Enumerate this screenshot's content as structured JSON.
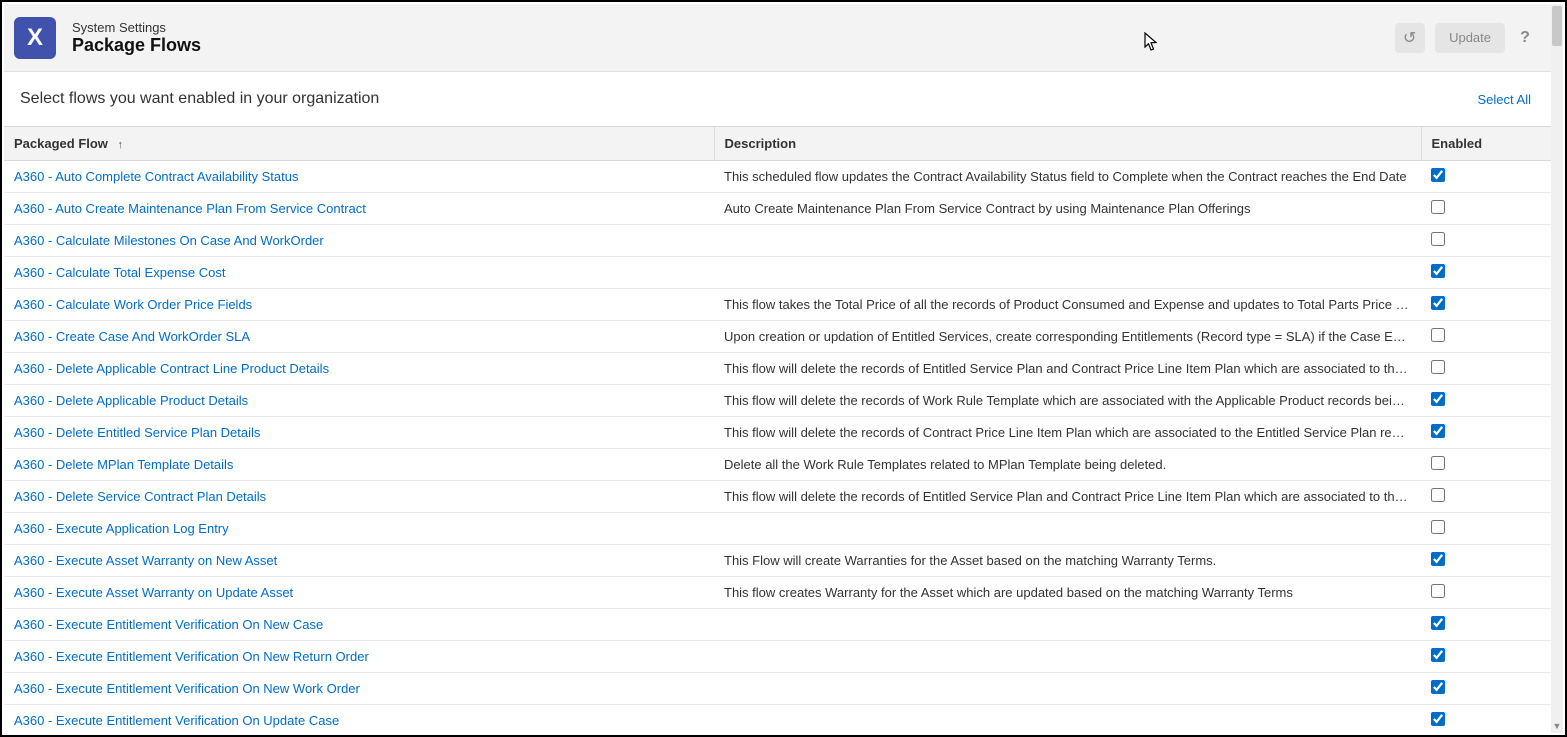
{
  "header": {
    "logo_letter": "X",
    "breadcrumb": "System Settings",
    "title": "Package Flows",
    "undo_label": "Undo",
    "update_label": "Update",
    "help_label": "?"
  },
  "subheader": {
    "text": "Select flows you want enabled in your organization",
    "select_all": "Select All"
  },
  "columns": {
    "flow": "Packaged Flow",
    "sort_indicator": "↑",
    "description": "Description",
    "enabled": "Enabled"
  },
  "rows": [
    {
      "name": "A360 - Auto Complete Contract Availability Status",
      "description": "This scheduled flow updates the Contract Availability Status field to Complete when the Contract reaches the End Date",
      "enabled": true
    },
    {
      "name": "A360 - Auto Create Maintenance Plan From Service Contract",
      "description": "Auto Create Maintenance Plan From Service Contract by using Maintenance Plan Offerings",
      "enabled": false
    },
    {
      "name": "A360 - Calculate Milestones On Case And WorkOrder",
      "description": "",
      "enabled": false
    },
    {
      "name": "A360 - Calculate Total Expense Cost",
      "description": "",
      "enabled": true
    },
    {
      "name": "A360 - Calculate Work Order Price Fields",
      "description": "This flow takes the Total Price of all the records of Product Consumed and Expense and updates to Total Parts Price and …",
      "enabled": true
    },
    {
      "name": "A360 - Create Case And WorkOrder SLA",
      "description": "Upon creation or updation of Entitled Services, create corresponding Entitlements (Record type = SLA) if the Case Entitl…",
      "enabled": false
    },
    {
      "name": "A360 - Delete Applicable Contract Line Product Details",
      "description": "This flow will delete the records of Entitled Service Plan and Contract Price Line Item Plan which are associated to the A…",
      "enabled": false
    },
    {
      "name": "A360 - Delete Applicable Product Details",
      "description": "This flow will delete the records of Work Rule Template which are associated with the Applicable Product records being …",
      "enabled": true
    },
    {
      "name": "A360 - Delete Entitled Service Plan Details",
      "description": "This flow will delete the records of Contract Price Line Item Plan which are associated to the Entitled Service Plan record…",
      "enabled": true
    },
    {
      "name": "A360 - Delete MPlan Template Details",
      "description": "Delete all the Work Rule Templates related to MPlan Template being deleted.",
      "enabled": false
    },
    {
      "name": "A360 - Delete Service Contract Plan Details",
      "description": "This flow will delete the records of Entitled Service Plan and Contract Price Line Item Plan which are associated to the C…",
      "enabled": false
    },
    {
      "name": "A360 - Execute Application Log Entry",
      "description": "",
      "enabled": false
    },
    {
      "name": "A360 - Execute Asset Warranty on New Asset",
      "description": "This Flow will create Warranties for the Asset based on the matching Warranty Terms.",
      "enabled": true
    },
    {
      "name": "A360 - Execute Asset Warranty on Update Asset",
      "description": "This flow creates Warranty for the Asset which are updated based on the matching Warranty Terms",
      "enabled": false
    },
    {
      "name": "A360 - Execute Entitlement Verification On New Case",
      "description": "",
      "enabled": true
    },
    {
      "name": "A360 - Execute Entitlement Verification On New Return Order",
      "description": "",
      "enabled": true
    },
    {
      "name": "A360 - Execute Entitlement Verification On New Work Order",
      "description": "",
      "enabled": true
    },
    {
      "name": "A360 - Execute Entitlement Verification On Update Case",
      "description": "",
      "enabled": true
    }
  ]
}
